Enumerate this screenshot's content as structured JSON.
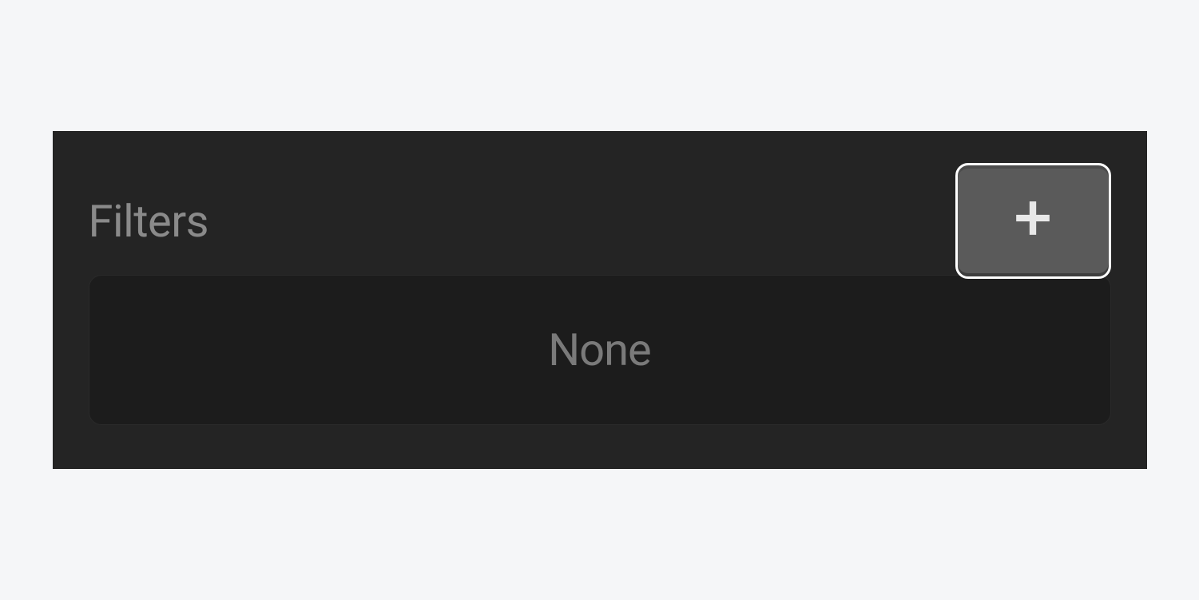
{
  "filters": {
    "title": "Filters",
    "empty_state": "None"
  }
}
